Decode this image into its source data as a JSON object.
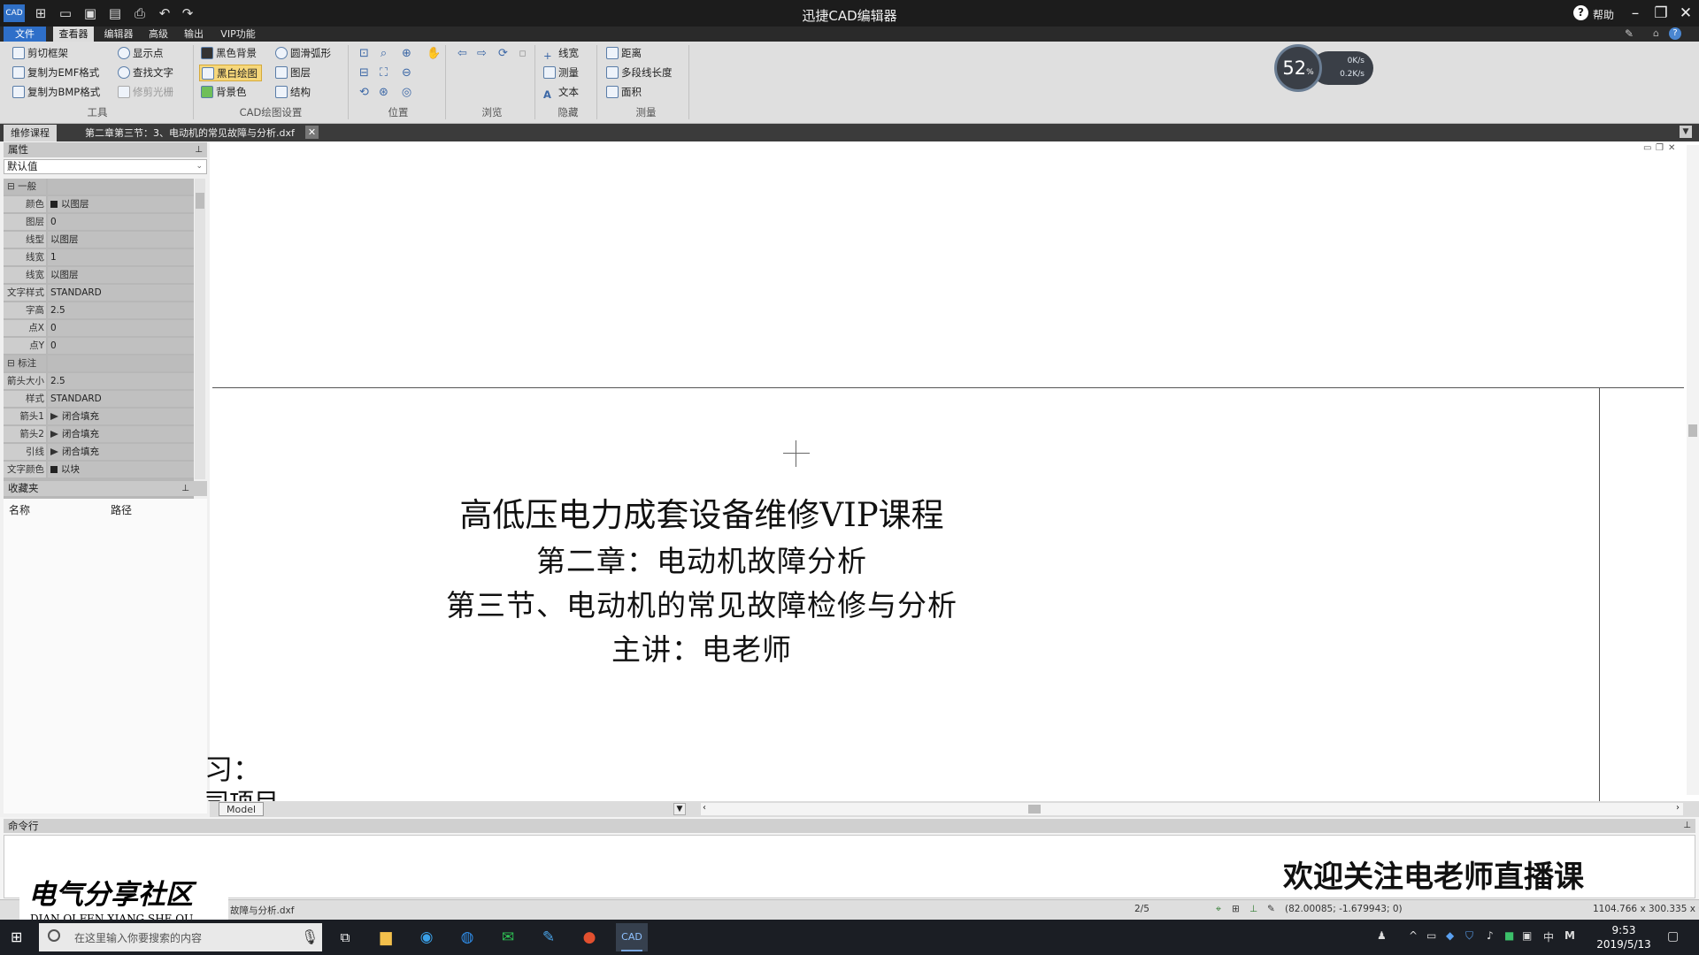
{
  "titlebar": {
    "app_title": "迅捷CAD编辑器",
    "app_icon": "CAD",
    "help_label": "帮助"
  },
  "menu": [
    {
      "label": "文件"
    },
    {
      "label": "查看器"
    },
    {
      "label": "编辑器"
    },
    {
      "label": "高级"
    },
    {
      "label": "输出"
    },
    {
      "label": "VIP功能"
    }
  ],
  "ribbon": {
    "tools": {
      "label": "工具",
      "items": [
        "剪切框架",
        "复制为EMF格式",
        "复制为BMP格式",
        "显示点",
        "查找文字",
        "修剪光栅"
      ]
    },
    "draw_settings": {
      "label": "CAD绘图设置",
      "items": [
        "黑色背景",
        "黑白绘图",
        "背景色",
        "圆滑弧形",
        "图层",
        "结构"
      ]
    },
    "position": {
      "label": "位置"
    },
    "browse": {
      "label": "浏览"
    },
    "hide": {
      "label": "隐藏",
      "items": [
        "线宽",
        "测量",
        "文本"
      ]
    },
    "measure": {
      "label": "测量",
      "items": [
        "距离",
        "多段线长度",
        "面积"
      ]
    }
  },
  "network": {
    "percent": "52",
    "unit": "%",
    "up": "0K/s",
    "down": "0.2K/s"
  },
  "tabs": [
    {
      "label": "维修课程"
    },
    {
      "label": "第二章第三节：3、电动机的常见故障与分析.dxf"
    }
  ],
  "properties": {
    "header": "属性",
    "combo": "默认值",
    "rows": [
      {
        "key": "一般",
        "value": ""
      },
      {
        "key": "颜色",
        "value": "以图层"
      },
      {
        "key": "图层",
        "value": "0"
      },
      {
        "key": "线型",
        "value": "以图层"
      },
      {
        "key": "线宽",
        "value": "1"
      },
      {
        "key": "线宽",
        "value": "以图层"
      },
      {
        "key": "文字样式",
        "value": "STANDARD"
      },
      {
        "key": "字高",
        "value": "2.5"
      },
      {
        "key": "点X",
        "value": "0"
      },
      {
        "key": "点Y",
        "value": "0"
      },
      {
        "key": "标注",
        "value": ""
      },
      {
        "key": "箭头大小",
        "value": "2.5"
      },
      {
        "key": "样式",
        "value": "STANDARD"
      },
      {
        "key": "箭头1",
        "value": "闭合填充"
      },
      {
        "key": "箭头2",
        "value": "闭合填充"
      },
      {
        "key": "引线",
        "value": "闭合填充"
      },
      {
        "key": "文字颜色",
        "value": "以块"
      }
    ]
  },
  "favorites": {
    "header": "收藏夹",
    "col_name": "名称",
    "col_path": "路径"
  },
  "canvas": {
    "title": "高低压电力成套设备维修VIP课程",
    "line2": "第二章：电动机故障分析",
    "line3": "第三节、电动机的常见故障检修与分析",
    "line4": "主讲：电老师",
    "partial1": "习：",
    "partial2": "司项目"
  },
  "model_tab": "Model",
  "command": {
    "header": "命令行",
    "overlay": "欢迎关注电老师直播课"
  },
  "watermark": {
    "cn": "电气分享社区",
    "en": "DIAN QI FEN XIANG SHE QU"
  },
  "status": {
    "file": "故障与分析.dxf",
    "page": "2/5",
    "coords": "(82.00085; -1.679943; 0)",
    "size": "1104.766 x 300.335 x 0"
  },
  "taskbar": {
    "search_placeholder": "在这里输入你要搜索的内容",
    "ime": "中",
    "time": "9:53",
    "date": "2019/5/13"
  }
}
